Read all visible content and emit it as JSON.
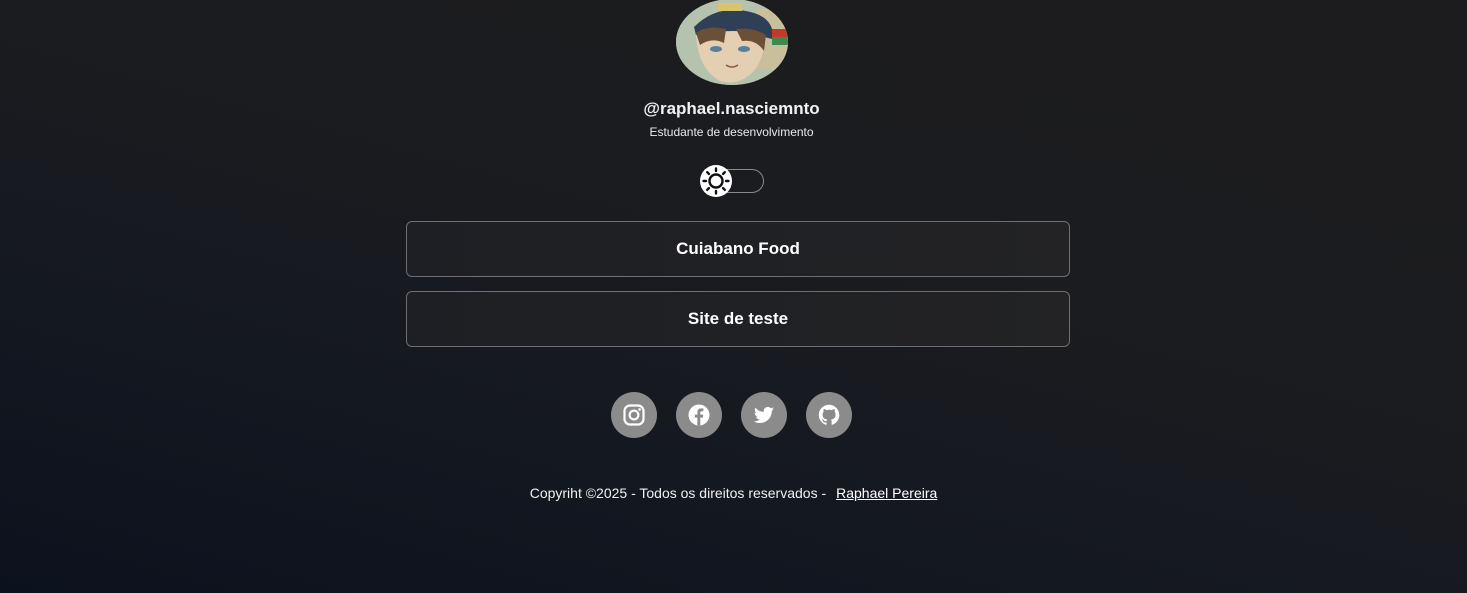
{
  "profile": {
    "username": "@raphael.nasciemnto",
    "bio": "Estudante de desenvolvimento",
    "avatar_icon": "avatar-illustration"
  },
  "theme_toggle": {
    "icon": "sun-icon",
    "state": "dark"
  },
  "links": [
    {
      "label": "Cuiabano Food"
    },
    {
      "label": "Site de teste"
    }
  ],
  "social": [
    {
      "icon": "instagram-icon"
    },
    {
      "icon": "facebook-icon"
    },
    {
      "icon": "twitter-icon"
    },
    {
      "icon": "github-icon"
    }
  ],
  "footer": {
    "text": "Copyriht ©2025 - Todos os direitos reservados -",
    "author_link": "Raphael Pereira"
  },
  "colors": {
    "background": "#15171c",
    "button_border": "#6e6e73",
    "social_bg": "#8b8b8b"
  }
}
